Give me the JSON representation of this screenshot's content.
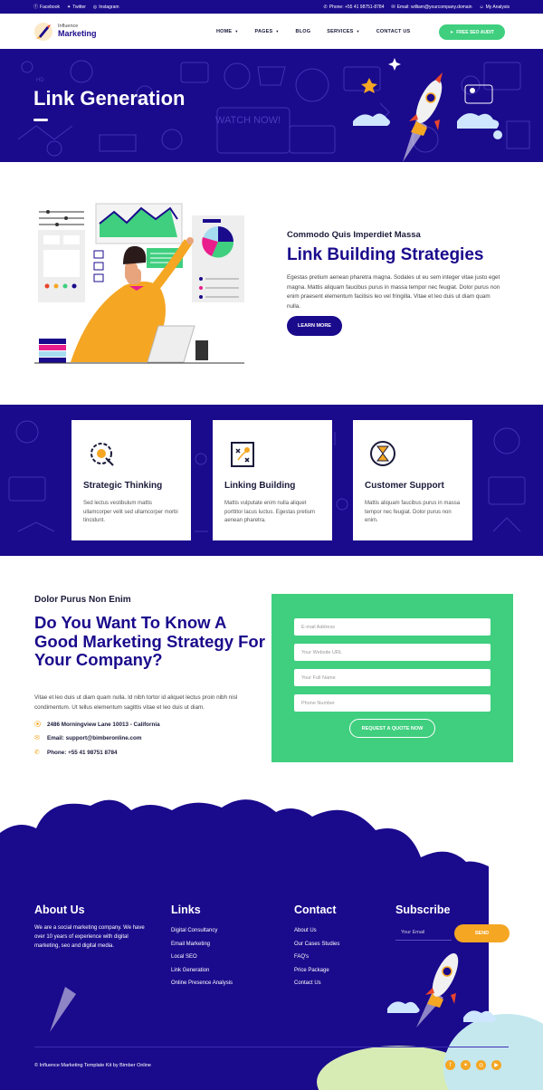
{
  "topbar": {
    "facebook": "Facebook",
    "twitter": "Twitter",
    "instagram": "Instagram",
    "phone": "Phone: +55 41 98751-8784",
    "email": "Email: william@yourcompany.domain",
    "account": "My Analysis"
  },
  "nav": {
    "logo_line1": "Influence",
    "logo_line2": "Marketing",
    "items": [
      {
        "label": "HOME",
        "caret": true
      },
      {
        "label": "PAGES",
        "caret": true
      },
      {
        "label": "BLOG",
        "caret": false
      },
      {
        "label": "SERVICES",
        "caret": true
      },
      {
        "label": "CONTACT US",
        "caret": false
      }
    ],
    "cta": "FREE SEO AUDIT"
  },
  "hero": {
    "title": "Link Generation",
    "doodle_text": "WATCH NOW!",
    "doodle_text2": "HD"
  },
  "intro": {
    "subtitle": "Commodo Quis Imperdiet Massa",
    "title": "Link Building Strategies",
    "body": "Egestas pretium aenean pharetra magna. Sodales ut eu sem integer vitae justo eget magna. Mattis aliquam faucibus purus in massa tempor nec feugiat. Dolor purus non enim praesent elementum facilisis leo vel fringilla. Vitae et leo duis ut diam quam nulla.",
    "button": "LEARN MORE"
  },
  "features": [
    {
      "icon": "gear-brain-icon",
      "title": "Strategic Thinking",
      "body": "Sed lectus vestibulum mattis ullamcorper velit sed ullamcorper morbi tincidunt."
    },
    {
      "icon": "strategy-board-icon",
      "title": "Linking Building",
      "body": "Mattis vulputate enim nulla aliquet porttitor lacus luctus. Egestas pretium aenean pharetra."
    },
    {
      "icon": "hourglass-support-icon",
      "title": "Customer Support",
      "body": "Mattis aliquam faucibus purus in massa tempor nec feugiat. Dolor purus non enim."
    }
  ],
  "quote": {
    "subtitle": "Dolor Purus Non Enim",
    "title": "Do You Want To Know A Good Marketing Strategy For Your Company?",
    "body": "Vitae et leo duis ut diam quam nulla. Id nibh tortor id aliquet lectus proin nibh nisl condimentum. Ut tellus elementum sagittis vitae et leo duis ut diam.",
    "address": "2486 Morningview Lane 10013 - California",
    "email": "Email: support@bimberonline.com",
    "phone": "Phone: +55 41 98751 8784",
    "form": {
      "email_placeholder": "E-mail Address",
      "website_placeholder": "Your Website URL",
      "name_placeholder": "Your Full Name",
      "phone_placeholder": "Phone Number",
      "button": "REQUEST A QUOTE NOW"
    }
  },
  "footer": {
    "about_title": "About Us",
    "about_text": "We are a social marketing company. We have over 10 years of experience with digital marketing, seo and digital media.",
    "links_title": "Links",
    "links": [
      "Digital Consultancy",
      "Email Marketing",
      "Local SEO",
      "Link Generation",
      "Online Presence Analysis"
    ],
    "contact_title": "Contact",
    "contact_links": [
      "About Us",
      "Our Cases Studies",
      "FAQ's",
      "Price Package",
      "Contact Us"
    ],
    "subscribe_title": "Subscribe",
    "email_placeholder": "Your Email",
    "send": "SEND",
    "copyright": "© Influence Marketing Template Kit by Bimber Online"
  },
  "colors": {
    "primary": "#1a0a8c",
    "green": "#3fcf7f",
    "orange": "#f5a623"
  }
}
